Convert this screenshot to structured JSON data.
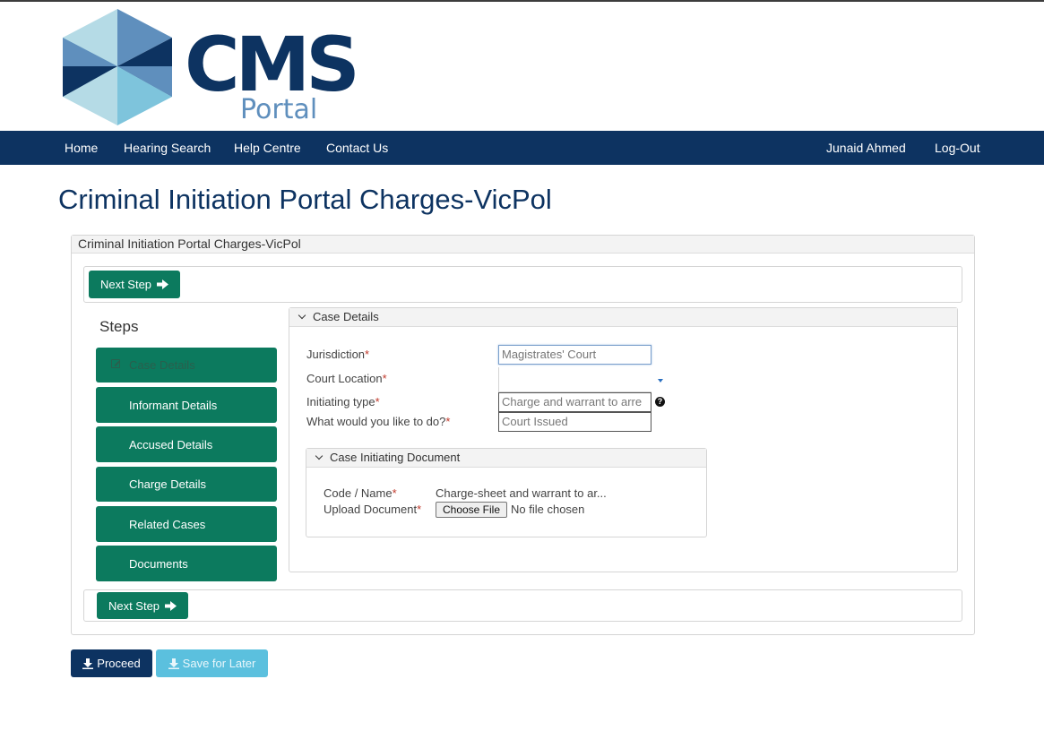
{
  "logo": {
    "word": "CMS",
    "subword": "Portal"
  },
  "nav": {
    "items": [
      "Home",
      "Hearing Search",
      "Help Centre",
      "Contact Us"
    ],
    "user": "Junaid Ahmed",
    "logout": "Log-Out"
  },
  "page": {
    "title": "Criminal Initiation Portal Charges-VicPol",
    "panel_title": "Criminal Initiation Portal Charges-VicPol"
  },
  "wizard": {
    "next_step": "Next Step",
    "steps_title": "Steps",
    "steps": [
      "Case Details",
      "Informant Details",
      "Accused Details",
      "Charge Details",
      "Related Cases",
      "Documents"
    ],
    "active_step": "Case Details"
  },
  "case_details": {
    "header": "Case Details",
    "fields": {
      "jurisdiction": {
        "label": "Jurisdiction",
        "value": "Magistrates' Court"
      },
      "court_location": {
        "label": "Court Location",
        "value": ""
      },
      "initiating_type": {
        "label": "Initiating type",
        "value": "Charge and warrant to arre"
      },
      "action": {
        "label": "What would you like to do?",
        "value": "Court Issued"
      }
    },
    "required_mark": "*",
    "help_glyph": "?"
  },
  "document": {
    "header": "Case Initiating Document",
    "code_label": "Code / Name",
    "code_value": "Charge-sheet and warrant to ar...",
    "upload_label": "Upload Document",
    "choose_file": "Choose File",
    "no_file": "No file chosen"
  },
  "actions": {
    "proceed": "Proceed",
    "save_later": "Save for Later"
  },
  "colors": {
    "brand_navy": "#0d3361",
    "step_green": "#0c7a5e",
    "save_blue": "#5bc0de"
  }
}
